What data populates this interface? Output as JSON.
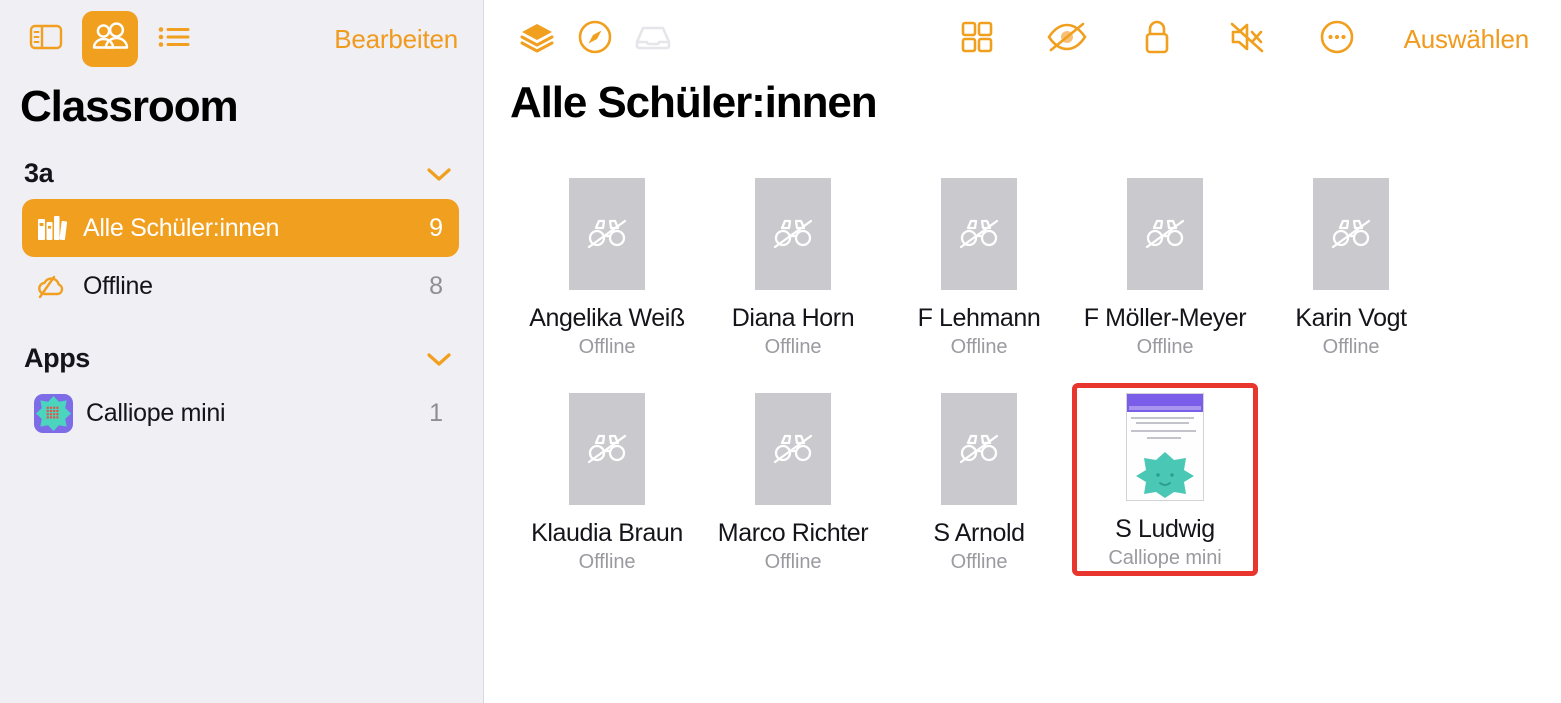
{
  "sidebar": {
    "toolbar": {
      "buttons": [
        {
          "name": "sidebar-toggle-icon",
          "label": "Seitenleiste",
          "active": false
        },
        {
          "name": "people-icon",
          "label": "Schüler:innen",
          "active": true
        },
        {
          "name": "list-icon",
          "label": "Liste",
          "active": false
        }
      ],
      "edit_label": "Bearbeiten"
    },
    "title": "Classroom",
    "groups": [
      {
        "name": "3a",
        "expanded": true,
        "items": [
          {
            "icon": "books-icon",
            "label": "Alle Schüler:innen",
            "count": "9",
            "selected": true
          },
          {
            "icon": "cloud-slash-icon",
            "label": "Offline",
            "count": "8",
            "selected": false
          }
        ]
      },
      {
        "name": "Apps",
        "expanded": true,
        "items": [
          {
            "icon": "calliope-app-icon",
            "label": "Calliope mini",
            "count": "1",
            "selected": false
          }
        ]
      }
    ]
  },
  "main": {
    "toolbar": {
      "left_buttons": [
        {
          "name": "layers-icon",
          "label": "Ebenen",
          "state": "active"
        },
        {
          "name": "compass-icon",
          "label": "Navigieren",
          "state": "active"
        },
        {
          "name": "inbox-tray-icon",
          "label": "Ablage",
          "state": "disabled"
        }
      ],
      "right_buttons": [
        {
          "name": "grid-view-icon",
          "label": "Raster"
        },
        {
          "name": "eye-slash-icon",
          "label": "Bildschirm sperren"
        },
        {
          "name": "lock-icon",
          "label": "Sperren"
        },
        {
          "name": "speaker-mute-icon",
          "label": "Stummschalten"
        },
        {
          "name": "more-ellipsis-icon",
          "label": "Mehr"
        }
      ],
      "select_label": "Auswählen"
    },
    "title": "Alle Schüler:innen",
    "students": [
      [
        {
          "name": "Angelika Weiß",
          "status": "Offline",
          "thumb": "offline",
          "highlight": false
        },
        {
          "name": "Diana Horn",
          "status": "Offline",
          "thumb": "offline",
          "highlight": false
        },
        {
          "name": "F Lehmann",
          "status": "Offline",
          "thumb": "offline",
          "highlight": false
        },
        {
          "name": "F Möller-Meyer",
          "status": "Offline",
          "thumb": "offline",
          "highlight": false
        },
        {
          "name": "Karin Vogt",
          "status": "Offline",
          "thumb": "offline",
          "highlight": false
        }
      ],
      [
        {
          "name": "Klaudia Braun",
          "status": "Offline",
          "thumb": "offline",
          "highlight": false
        },
        {
          "name": "Marco Richter",
          "status": "Offline",
          "thumb": "offline",
          "highlight": false
        },
        {
          "name": "S Arnold",
          "status": "Offline",
          "thumb": "offline",
          "highlight": false
        },
        {
          "name": "S Ludwig",
          "status": "Calliope mini",
          "thumb": "screenshot",
          "highlight": true
        }
      ]
    ]
  },
  "colors": {
    "accent_orange": "#F19F1E",
    "sidebar_bg": "#EFEFF4",
    "tile_gray": "#C9C9CE",
    "status_gray": "#9A9AA0",
    "highlight_red": "#E8352D",
    "app_purple": "#7D6BE8",
    "app_teal": "#4BC7B5"
  }
}
